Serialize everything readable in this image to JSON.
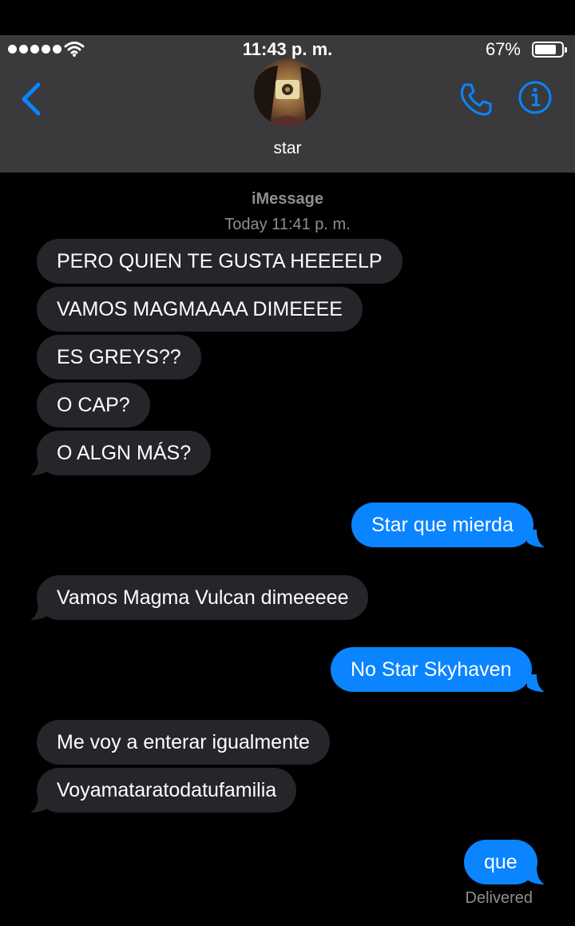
{
  "status_bar": {
    "time": "11:43 p. m.",
    "battery": "67%"
  },
  "header": {
    "contact_name": "star"
  },
  "thread": {
    "service": "iMessage",
    "timestamp": "Today 11:41 p. m."
  },
  "messages": [
    {
      "direction": "received",
      "text": "PERO QUIEN TE GUSTA HEEEELP"
    },
    {
      "direction": "received",
      "text": "VAMOS MAGMAAAA DIMEEEE"
    },
    {
      "direction": "received",
      "text": "ES GREYS??"
    },
    {
      "direction": "received",
      "text": "O CAP?"
    },
    {
      "direction": "received",
      "text": "O ALGN MÁS?"
    },
    {
      "direction": "sent",
      "text": "Star que mierda"
    },
    {
      "direction": "received",
      "text": "Vamos Magma Vulcan dimeeeee"
    },
    {
      "direction": "sent",
      "text": "No Star Skyhaven"
    },
    {
      "direction": "received",
      "text": "Me voy a enterar igualmente"
    },
    {
      "direction": "received",
      "text": "Voyamataratodatufamilia"
    },
    {
      "direction": "sent",
      "text": "que"
    }
  ],
  "delivery_status": "Delivered",
  "colors": {
    "sent_bubble": "#0a84ff",
    "received_bubble": "#26252a",
    "accent": "#0a84ff",
    "bar_bg": "#3a3a3c"
  }
}
